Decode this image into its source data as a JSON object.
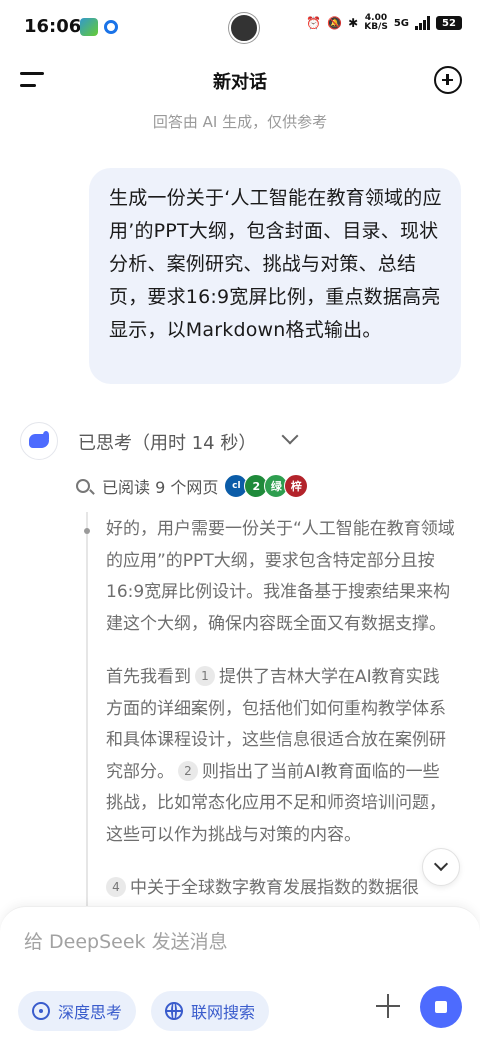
{
  "status_bar": {
    "time": "16:06",
    "center_text": "( )",
    "network_speed": "4.00\nKB/S",
    "network_type": "5G",
    "battery": "52",
    "icons": [
      "app-icon-1",
      "app-icon-2",
      "avatar-icon",
      "alarm-icon",
      "mute-icon",
      "bluetooth-icon",
      "signal-icon",
      "battery-icon"
    ]
  },
  "header": {
    "title": "新对话",
    "disclaimer": "回答由 AI 生成，仅供参考"
  },
  "user_message": {
    "text": "生成一份关于‘人工智能在教育领域的应用’的PPT大纲，包含封面、目录、现状分析、案例研究、挑战与对策、总结页，要求16:9宽屏比例，重点数据高亮显示，以Markdown格式输出。"
  },
  "assistant": {
    "thinking_status": "已思考（用时 14 秒）",
    "read_pages": "已阅读 9 个网页",
    "site_badges": [
      "cl",
      "2",
      "绿",
      "梓"
    ],
    "thinking_paragraph_1": "好的，用户需要一份关于“人工智能在教育领域的应用”的PPT大纲，要求包含特定部分且按16:9宽屏比例设计。我准备基于搜索结果来构建这个大纲，确保内容既全面又有数据支撑。",
    "p2_a": "首先我看到",
    "cite_1": "1",
    "p2_b": "提供了吉林大学在AI教育实践方面的详细案例，包括他们如何重构教学体系和具体课程设计，这些信息很适合放在案例研究部分。",
    "cite_2": "2",
    "p2_c": "则指出了当前AI教育面临的一些挑战，比如常态化应用不足和师资培训问题，这些可以作为挑战与对策的内容。",
    "cite_4": "4",
    "p3": "中关于全球数字教育发展指数的数据很"
  },
  "composer": {
    "placeholder": "给 DeepSeek 发送消息",
    "deep_think_label": "深度思考",
    "web_search_label": "联网搜索"
  },
  "colors": {
    "accent": "#4d6bfe",
    "bubble": "#eef2fb",
    "chip_bg": "#eaf0fb",
    "chip_text": "#3a5ccc"
  }
}
